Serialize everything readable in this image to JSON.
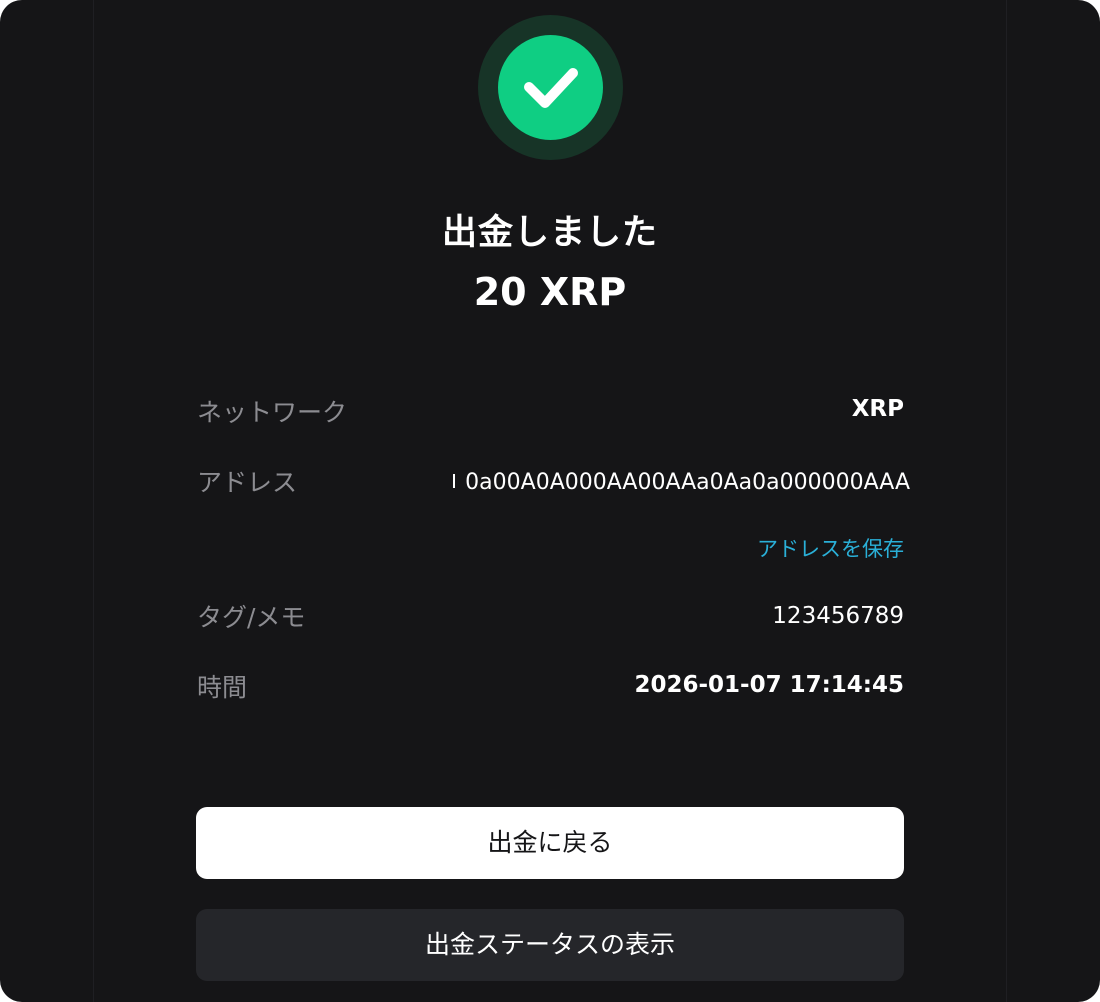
{
  "success": {
    "icon": "check-icon",
    "colors": {
      "ring": "#173427",
      "fill": "#0fce83"
    }
  },
  "header": {
    "title": "出金しました",
    "amount": "20 XRP"
  },
  "details": {
    "network_label": "ネットワーク",
    "network_value": "XRP",
    "address_label": "アドレス",
    "address_value": "0a00A0A000AA00AAa0Aa0a000000AAA",
    "save_address_link": "アドレスを保存",
    "tag_label": "タグ/メモ",
    "tag_value": "123456789",
    "time_label": "時間",
    "time_value": "2026-01-07 17:14:45"
  },
  "actions": {
    "back_label": "出金に戻る",
    "status_label": "出金ステータスの表示"
  },
  "theme": {
    "background": "#151517",
    "link": "#2ab0d8"
  }
}
